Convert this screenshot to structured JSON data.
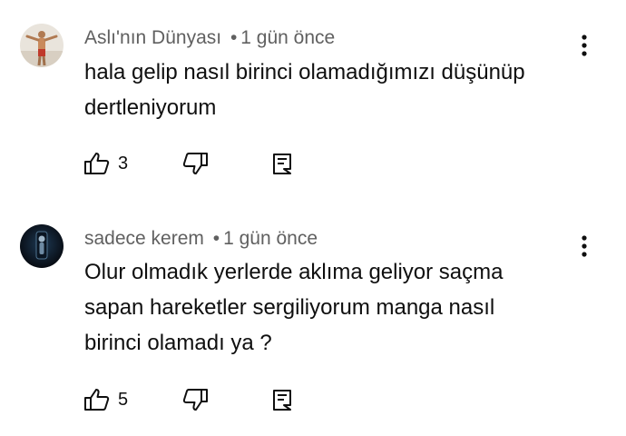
{
  "comments": [
    {
      "author": "Aslı'nın Dünyası",
      "separator": "•",
      "time": "1 gün önce",
      "text_lines": [
        "hala gelip nasıl birinci olamadığımızı düşünüp",
        "dertleniyorum"
      ],
      "likes": "3",
      "avatar_icon": "person-photo-avatar",
      "avatar_colors": [
        "#e8e2da",
        "#c98a5c",
        "#7a5c44"
      ]
    },
    {
      "author": "sadece kerem",
      "separator": "•",
      "time": "1 gün önce",
      "text_lines": [
        "Olur olmadık yerlerde aklıma geliyor saçma",
        "sapan hareketler sergiliyorum manga nasıl",
        "birinci olamadı ya ?"
      ],
      "likes": "5",
      "avatar_icon": "dark-figure-avatar",
      "avatar_colors": [
        "#0d1420",
        "#1e3a55",
        "#9fb6c8"
      ]
    }
  ],
  "icons": {
    "like": "thumbs-up-icon",
    "dislike": "thumbs-down-icon",
    "reply": "reply-comment-icon",
    "more": "more-options-icon"
  },
  "colors": {
    "text_primary": "#0f0f0f",
    "text_secondary": "#606060",
    "icon": "#0f0f0f"
  }
}
